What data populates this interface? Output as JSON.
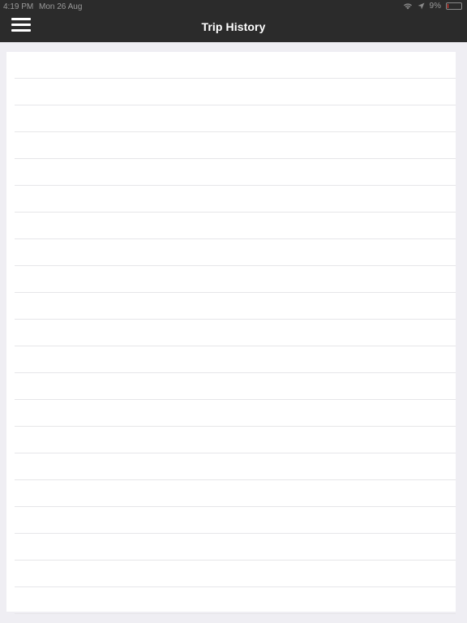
{
  "status_bar": {
    "time": "4:19 PM",
    "date": "Mon 26 Aug",
    "battery": "9%",
    "battery_level": 0.09
  },
  "header": {
    "title": "Trip History",
    "menu_icon": "hamburger-icon"
  },
  "trip_list": {
    "row_count": 21,
    "rows": []
  },
  "colors": {
    "header_bg": "#2b2b2b",
    "page_bg": "#efeef3",
    "card_bg": "#ffffff",
    "divider": "#e6e6e9",
    "battery_low": "#ff3b30"
  }
}
